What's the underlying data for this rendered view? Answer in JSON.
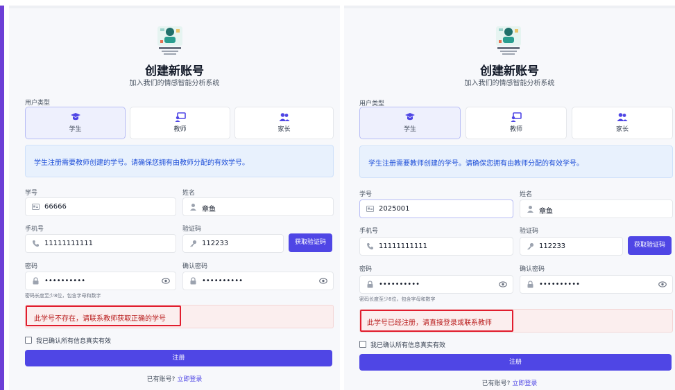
{
  "panels": [
    {
      "title": "创建新账号",
      "subtitle": "加入我们的情感智能分析系统",
      "user_type_label": "用户类型",
      "user_types": [
        {
          "label": "学生",
          "icon": "graduation-cap-icon",
          "selected": true
        },
        {
          "label": "教师",
          "icon": "chalkboard-teacher-icon",
          "selected": false
        },
        {
          "label": "家长",
          "icon": "users-icon",
          "selected": false
        }
      ],
      "info_text": "学生注册需要教师创建的学号。请确保您拥有由教师分配的有效学号。",
      "student_id_label": "学号",
      "student_id_value": "66666",
      "name_label": "姓名",
      "name_value": "章鱼",
      "phone_label": "手机号",
      "phone_value": "11111111111",
      "code_label": "验证码",
      "code_value": "112233",
      "code_button": "获取验证码",
      "password_label": "密码",
      "password_value": "••••••••••",
      "confirm_label": "确认密码",
      "confirm_value": "••••••••••",
      "password_hint": "密码长度至少8位，包含字母和数字",
      "error_text": "此学号不存在，请联系教师获取正确的学号",
      "checkbox_label": "我已确认所有信息真实有效",
      "submit_label": "注册",
      "login_prompt": "已有账号?",
      "login_link": "立即登录"
    },
    {
      "title": "创建新账号",
      "subtitle": "加入我们的情感智能分析系统",
      "user_type_label": "用户类型",
      "user_types": [
        {
          "label": "学生",
          "icon": "graduation-cap-icon",
          "selected": true
        },
        {
          "label": "教师",
          "icon": "chalkboard-teacher-icon",
          "selected": false
        },
        {
          "label": "家长",
          "icon": "users-icon",
          "selected": false
        }
      ],
      "info_text": "学生注册需要教师创建的学号。请确保您拥有由教师分配的有效学号。",
      "student_id_label": "学号",
      "student_id_value": "2025001",
      "name_label": "姓名",
      "name_value": "章鱼",
      "phone_label": "手机号",
      "phone_value": "11111111111",
      "code_label": "验证码",
      "code_value": "112233",
      "code_button": "获取验证码",
      "password_label": "密码",
      "password_value": "••••••••••",
      "confirm_label": "确认密码",
      "confirm_value": "••••••••••",
      "password_hint": "密码长度至少8位，包含字母和数字",
      "error_text": "此学号已经注册，请直接登录或联系教师",
      "checkbox_label": "我已确认所有信息真实有效",
      "submit_label": "注册",
      "login_prompt": "已有账号?",
      "login_link": "立即登录"
    }
  ],
  "colors": {
    "accent_bar": "#6d3fd6",
    "primary_button": "#4f46e5",
    "info_background": "#e8f1fd",
    "info_text": "#1d4ed8",
    "error_background": "#fbeeee",
    "error_highlight": "#e11d2e",
    "error_text": "#b91c1c"
  }
}
